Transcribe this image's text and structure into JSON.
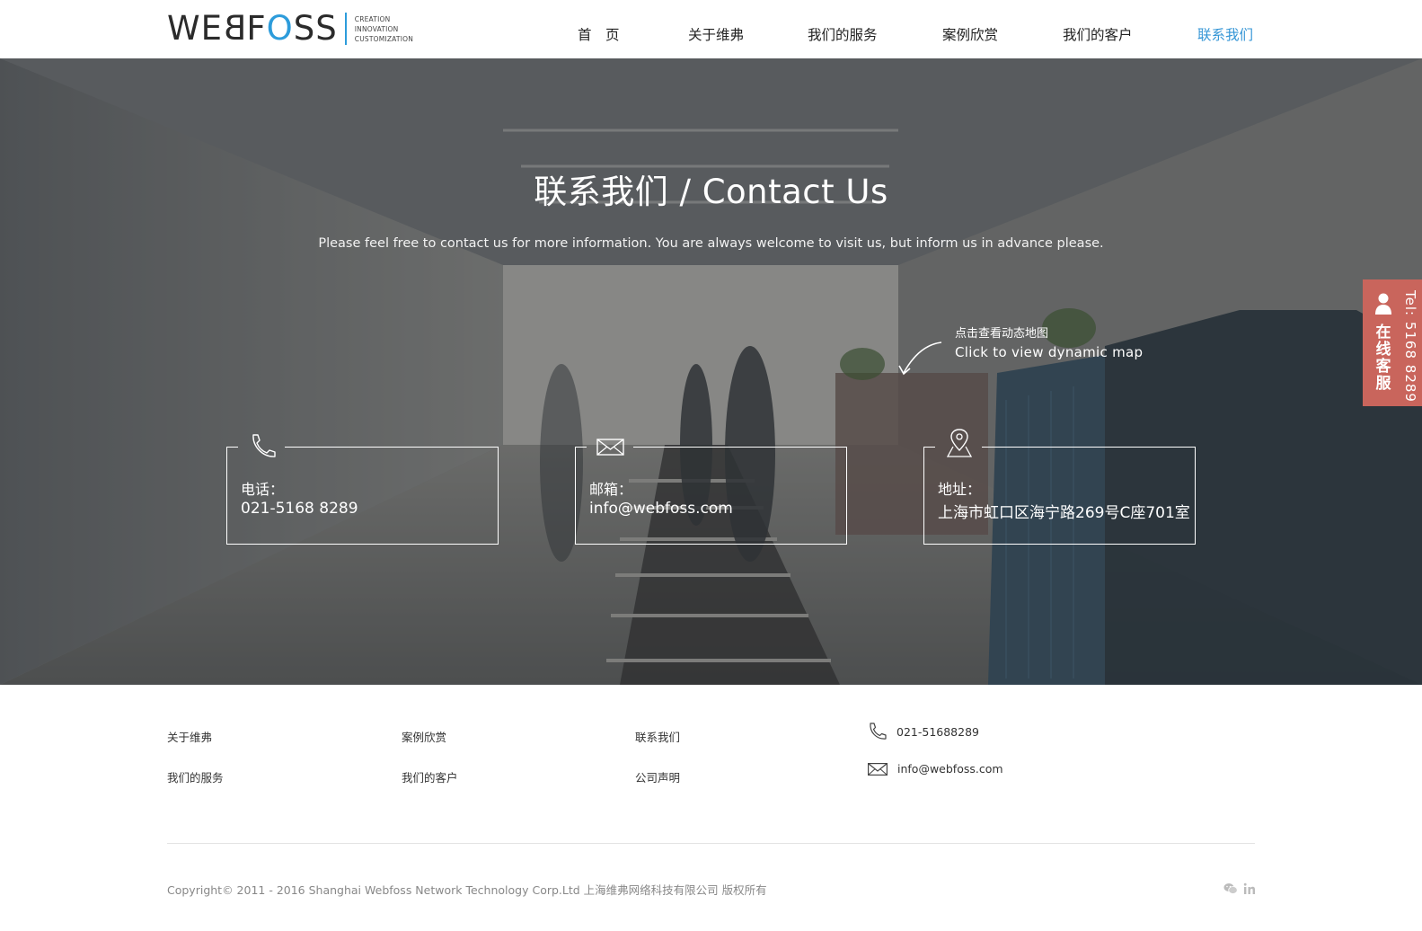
{
  "header": {
    "logo": {
      "word_left": "WE",
      "word_b": "B",
      "word_f": "F",
      "word_o": "O",
      "word_right": "SS",
      "tag_line1": "CREATION",
      "tag_line2": "INNOVATION",
      "tag_line3": "CUSTOMIZATION"
    },
    "nav": [
      {
        "label": "首　页"
      },
      {
        "label": "关于维弗"
      },
      {
        "label": "我们的服务"
      },
      {
        "label": "案例欣赏"
      },
      {
        "label": "我们的客户"
      },
      {
        "label": "联系我们"
      }
    ],
    "active_color": "#3596d6"
  },
  "hero": {
    "title": "联系我们 / Contact Us",
    "subtitle": "Please feel free to contact us for more information. You are always welcome to visit us, but inform us in advance please.",
    "map_hint_cn": "点击查看动态地图",
    "map_hint_en": "Click to view dynamic map",
    "cards": [
      {
        "icon": "phone-icon",
        "label": "电话：",
        "value": "021-5168 8289"
      },
      {
        "icon": "mail-icon",
        "label": "邮箱：",
        "value": "info@webfoss.com"
      },
      {
        "icon": "location-pin-icon",
        "label": "地址：",
        "value": "上海市虹口区海宁路269号C座701室"
      }
    ]
  },
  "side_tab": {
    "label": "在线客服",
    "tel": "Tel: 5168 8289",
    "color": "#c9655c"
  },
  "footer": {
    "links_col1": [
      "关于维弗",
      "我们的服务"
    ],
    "links_col2": [
      "案例欣赏",
      "我们的客户"
    ],
    "links_col3": [
      "联系我们",
      "公司声明"
    ],
    "phone": "021-51688289",
    "email": "info@webfoss.com",
    "copyright": "Copyright© 2011 - 2016 Shanghai Webfoss Network Technology Corp.Ltd 上海维弗网络科技有限公司 版权所有",
    "social": [
      "wechat-icon",
      "linkedin-icon"
    ]
  }
}
